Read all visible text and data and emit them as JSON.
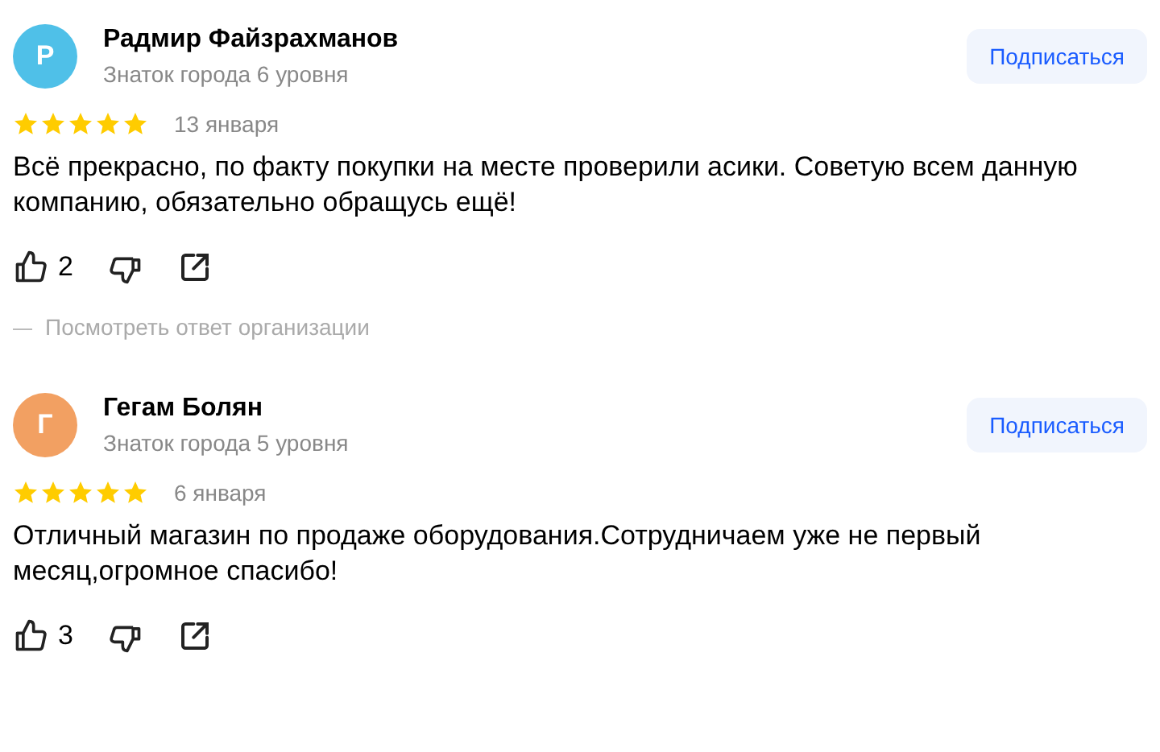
{
  "reviews": [
    {
      "initial": "Р",
      "color": "#4fc0e8",
      "name": "Радмир Файзрахманов",
      "level": "Знаток города 6 уровня",
      "subscribe": "Подписаться",
      "stars": 5,
      "date": "13 января",
      "text": "Всё прекрасно, по факту покупки на месте проверили асики. Советую всем данную компанию, обязательно обращусь ещё!",
      "likes": "2",
      "reply_link": "Посмотреть ответ организации"
    },
    {
      "initial": "Г",
      "color": "#f2a062",
      "name": "Гегам Болян",
      "level": "Знаток города 5 уровня",
      "subscribe": "Подписаться",
      "stars": 5,
      "date": "6 января",
      "text": "Отличный магазин по продаже оборудования.Сотрудничаем уже не первый месяц,огромное спасибо!",
      "likes": "3"
    }
  ]
}
